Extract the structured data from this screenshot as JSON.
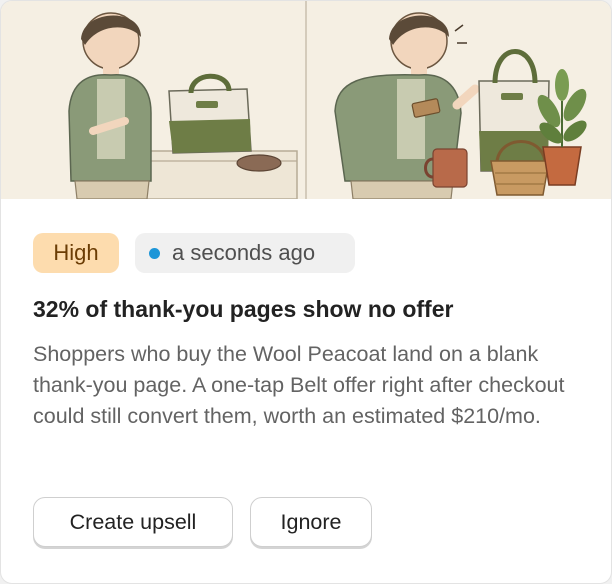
{
  "card": {
    "priority_label": "High",
    "timestamp": "a seconds ago",
    "title": "32% of thank-you pages show no offer",
    "description": "Shoppers who buy the Wool Peacoat land on a blank thank-you page. A one-tap Belt offer right after checkout could still convert them, worth an estimated $210/mo.",
    "actions": {
      "create_label": "Create upsell",
      "ignore_label": "Ignore"
    }
  },
  "colors": {
    "priority_bg": "#fddcae",
    "priority_text": "#6b3d05",
    "status_dot": "#1d96d8",
    "illustration_bg": "#f5efe3"
  },
  "icons": {
    "status": "status-dot-icon"
  }
}
